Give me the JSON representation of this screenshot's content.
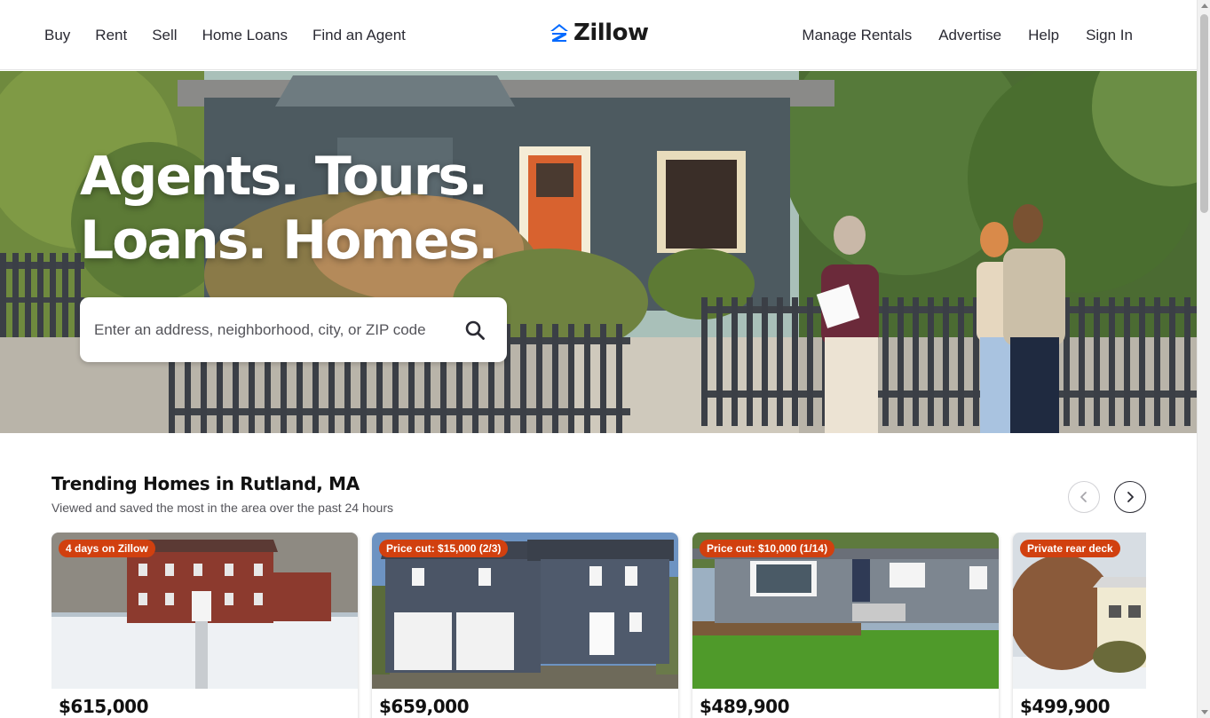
{
  "header": {
    "nav_left": [
      "Buy",
      "Rent",
      "Sell",
      "Home Loans",
      "Find an Agent"
    ],
    "logo_text": "Zillow",
    "nav_right": [
      "Manage Rentals",
      "Advertise",
      "Help",
      "Sign In"
    ]
  },
  "hero": {
    "title_line1": "Agents. Tours.",
    "title_line2": "Loans. Homes.",
    "search_placeholder": "Enter an address, neighborhood, city, or ZIP code"
  },
  "trending": {
    "title": "Trending Homes in Rutland, MA",
    "subtitle": "Viewed and saved the most in the area over the past 24 hours",
    "cards": [
      {
        "badge": "4 days on Zillow",
        "price": "$615,000"
      },
      {
        "badge": "Price cut: $15,000 (2/3)",
        "price": "$659,000"
      },
      {
        "badge": "Price cut: $10,000 (1/14)",
        "price": "$489,900"
      },
      {
        "badge": "Private rear deck",
        "price": "$499,900"
      }
    ]
  },
  "colors": {
    "brand_blue": "#006aff",
    "badge_orange": "#d1400f"
  },
  "icons": [
    "zillow-logo-icon",
    "search-icon",
    "chevron-left-icon",
    "chevron-right-icon"
  ]
}
